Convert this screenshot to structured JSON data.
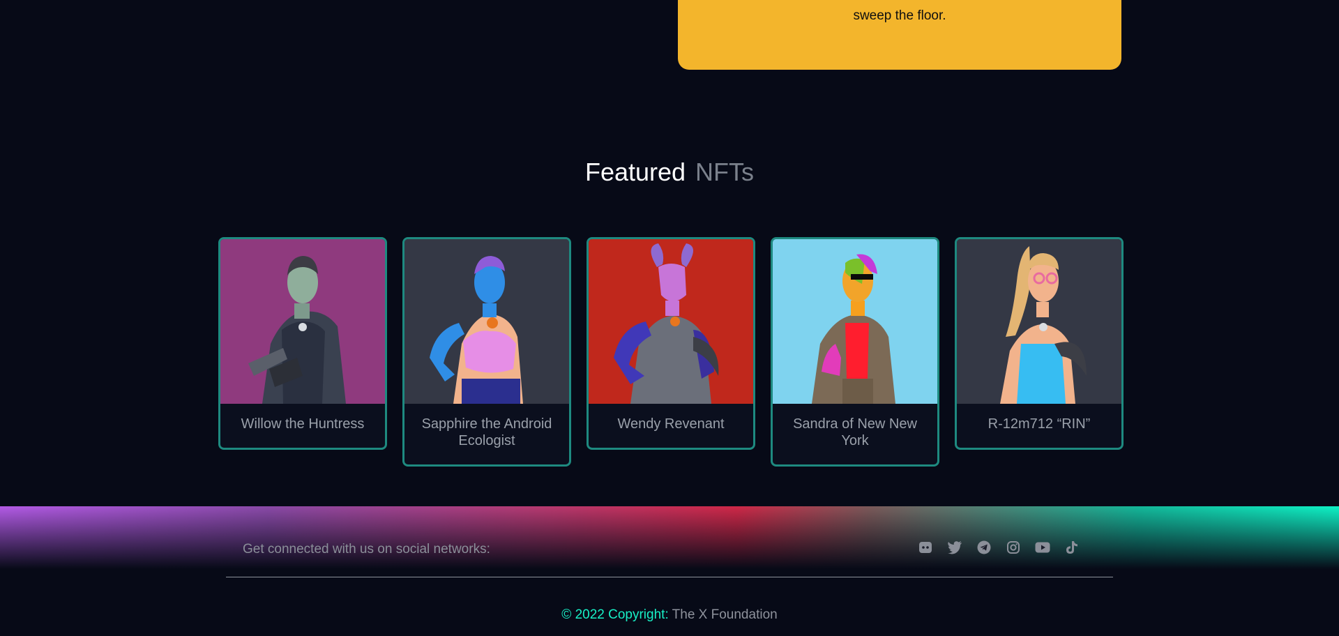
{
  "top_card": {
    "text": "sweep the floor."
  },
  "featured": {
    "title_word1": "Featured",
    "title_word2": "NFTs",
    "items": [
      {
        "name": "Willow the Huntress",
        "bg": "#8f3a7e"
      },
      {
        "name": "Sapphire the Android Ecologist",
        "bg": "#343845"
      },
      {
        "name": "Wendy Revenant",
        "bg": "#c0281c"
      },
      {
        "name": "Sandra of New New York",
        "bg": "#7fd3ef"
      },
      {
        "name": "R-12m712 “RIN”",
        "bg": "#343845"
      }
    ]
  },
  "footer": {
    "social_text": "Get connected with us on social networks:",
    "social_icons": [
      "discord-icon",
      "twitter-icon",
      "telegram-icon",
      "instagram-icon",
      "youtube-icon",
      "tiktok-icon"
    ],
    "copyright_prefix": "© 2022 Copyright:",
    "copyright_org": "The X Foundation"
  },
  "colors": {
    "accent": "#18f0c6",
    "card_border": "#1e8a80",
    "yellow": "#f3b52c",
    "background": "#070a17"
  }
}
